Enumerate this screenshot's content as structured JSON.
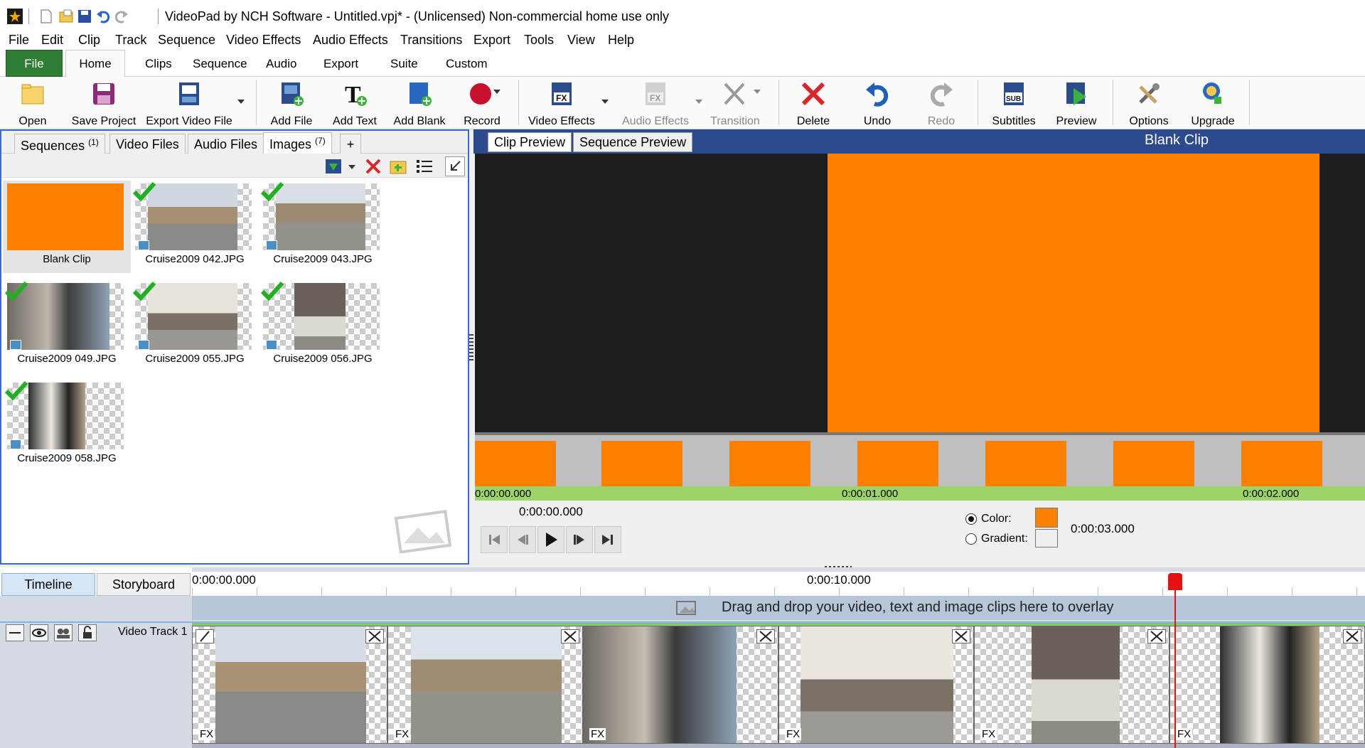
{
  "window": {
    "title": "VideoPad by NCH Software - Untitled.vpj* - (Unlicensed) Non-commercial home use only"
  },
  "menu": [
    "File",
    "Edit",
    "Clip",
    "Track",
    "Sequence",
    "Video Effects",
    "Audio Effects",
    "Transitions",
    "Export",
    "Tools",
    "View",
    "Help"
  ],
  "ribbon_tabs": [
    "File",
    "Home",
    "Clips",
    "Sequence",
    "Audio",
    "Export",
    "Suite",
    "Custom"
  ],
  "active_ribbon_tab": "Home",
  "toolbar": {
    "open": "Open",
    "save_project": "Save Project",
    "export_video_file": "Export Video File",
    "add_file": "Add File",
    "add_text": "Add Text",
    "add_blank": "Add Blank",
    "record": "Record",
    "video_effects": "Video Effects",
    "audio_effects": "Audio Effects",
    "transition": "Transition",
    "delete": "Delete",
    "undo": "Undo",
    "redo": "Redo",
    "subtitles": "Subtitles",
    "preview": "Preview",
    "options": "Options",
    "upgrade": "Upgrade"
  },
  "media_tabs": {
    "sequences": "Sequences",
    "sequences_count": "(1)",
    "video_files": "Video Files",
    "audio_files": "Audio Files",
    "images": "Images",
    "images_count": "(7)",
    "add": "+"
  },
  "media_items": [
    {
      "caption": "Blank Clip"
    },
    {
      "caption": "Cruise2009 042.JPG"
    },
    {
      "caption": "Cruise2009 043.JPG"
    },
    {
      "caption": "Cruise2009 049.JPG"
    },
    {
      "caption": "Cruise2009 055.JPG"
    },
    {
      "caption": "Cruise2009 056.JPG"
    },
    {
      "caption": "Cruise2009 058.JPG"
    }
  ],
  "preview": {
    "tab_clip": "Clip Preview",
    "tab_sequence": "Sequence Preview",
    "title": "Blank Clip",
    "clip_color": "#fd8000",
    "ruler_labels": [
      "0:00:00.000",
      "0:00:01.000",
      "0:00:02.000"
    ],
    "current_time": "0:00:00.000",
    "color_label": "Color:",
    "gradient_label": "Gradient:",
    "duration": "0:00:03.000"
  },
  "timeline": {
    "tab_timeline": "Timeline",
    "tab_storyboard": "Storyboard",
    "ruler_start": "0:00:00.000",
    "ruler_mid": "0:00:10.000",
    "overlay_hint": "Drag and drop your video, text and image clips here to overlay",
    "track_name": "Video Track 1",
    "fx_label": "FX"
  }
}
